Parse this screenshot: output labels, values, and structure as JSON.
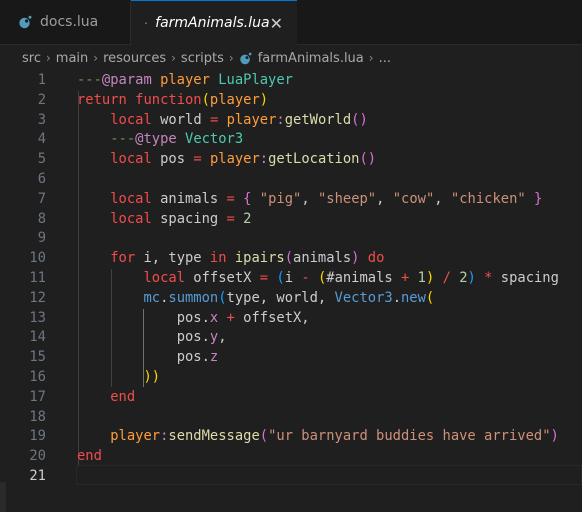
{
  "tabs": [
    {
      "label": "docs.lua",
      "active": false
    },
    {
      "label": "farmAnimals.lua",
      "active": true,
      "close": "✕"
    }
  ],
  "breadcrumb": [
    "src",
    "main",
    "resources",
    "scripts",
    "farmAnimals.lua",
    "..."
  ],
  "line_numbers": [
    "1",
    "2",
    "3",
    "4",
    "5",
    "6",
    "7",
    "8",
    "9",
    "10",
    "11",
    "12",
    "13",
    "14",
    "15",
    "16",
    "17",
    "18",
    "19",
    "20",
    "21"
  ],
  "active_line": "21",
  "code": {
    "l1": {
      "a": "---",
      "b": "@param",
      "c": " player ",
      "d": "LuaPlayer"
    },
    "l2": {
      "a": "return",
      "b": " ",
      "c": "function",
      "d": "(",
      "e": "player",
      "f": ")"
    },
    "l3": {
      "a": "local",
      "b": " world ",
      "c": "=",
      "d": " ",
      "e": "player",
      "f": ":",
      "g": "getWorld",
      "h": "()"
    },
    "l4": {
      "a": "---",
      "b": "@type",
      "c": " Vector3"
    },
    "l5": {
      "a": "local",
      "b": " pos ",
      "c": "=",
      "d": " ",
      "e": "player",
      "f": ":",
      "g": "getLocation",
      "h": "()"
    },
    "l7": {
      "a": "local",
      "b": " animals ",
      "c": "=",
      "d": " ",
      "e": "{",
      "f": " ",
      "g": "\"pig\"",
      "h": ", ",
      "i": "\"sheep\"",
      "j": ", ",
      "k": "\"cow\"",
      "l": ", ",
      "m": "\"chicken\"",
      "n": " ",
      "o": "}"
    },
    "l8": {
      "a": "local",
      "b": " spacing ",
      "c": "=",
      "d": " ",
      "e": "2"
    },
    "l10": {
      "a": "for",
      "b": " i, type ",
      "c": "in",
      "d": " ",
      "e": "ipairs",
      "f": "(",
      "g": "animals",
      "h": ")",
      "i": " ",
      "j": "do"
    },
    "l11": {
      "a": "local",
      "b": " offsetX ",
      "c": "=",
      "d": " ",
      "e": "(",
      "f": "i ",
      "g": "-",
      "h": " ",
      "i": "(",
      "j": "#animals ",
      "k": "+",
      "l": " ",
      "m": "1",
      "n": ")",
      "o": " ",
      "p": "/",
      "q": " ",
      "r": "2",
      "s": ")",
      "t": " ",
      "u": "*",
      "v": " spacing"
    },
    "l12": {
      "a": "mc",
      "b": ".",
      "c": "summon",
      "d": "(",
      "e": "type, world, ",
      "f": "Vector3",
      "g": ".",
      "h": "new",
      "i": "("
    },
    "l13": {
      "a": "pos",
      "b": ".",
      "c": "x",
      "d": " ",
      "e": "+",
      "f": " offsetX,"
    },
    "l14": {
      "a": "pos",
      "b": ".",
      "c": "y",
      "d": ","
    },
    "l15": {
      "a": "pos",
      "b": ".",
      "c": "z"
    },
    "l16": {
      "a": "))"
    },
    "l17": {
      "a": "end"
    },
    "l19": {
      "a": "player",
      "b": ":",
      "c": "sendMessage",
      "d": "(",
      "e": "\"ur barnyard buddies have arrived\"",
      "f": ")"
    },
    "l20": {
      "a": "end"
    }
  },
  "colors": {
    "accent": "#0078d4",
    "background": "#1f1f1f",
    "lua_icon": "#519aba"
  }
}
